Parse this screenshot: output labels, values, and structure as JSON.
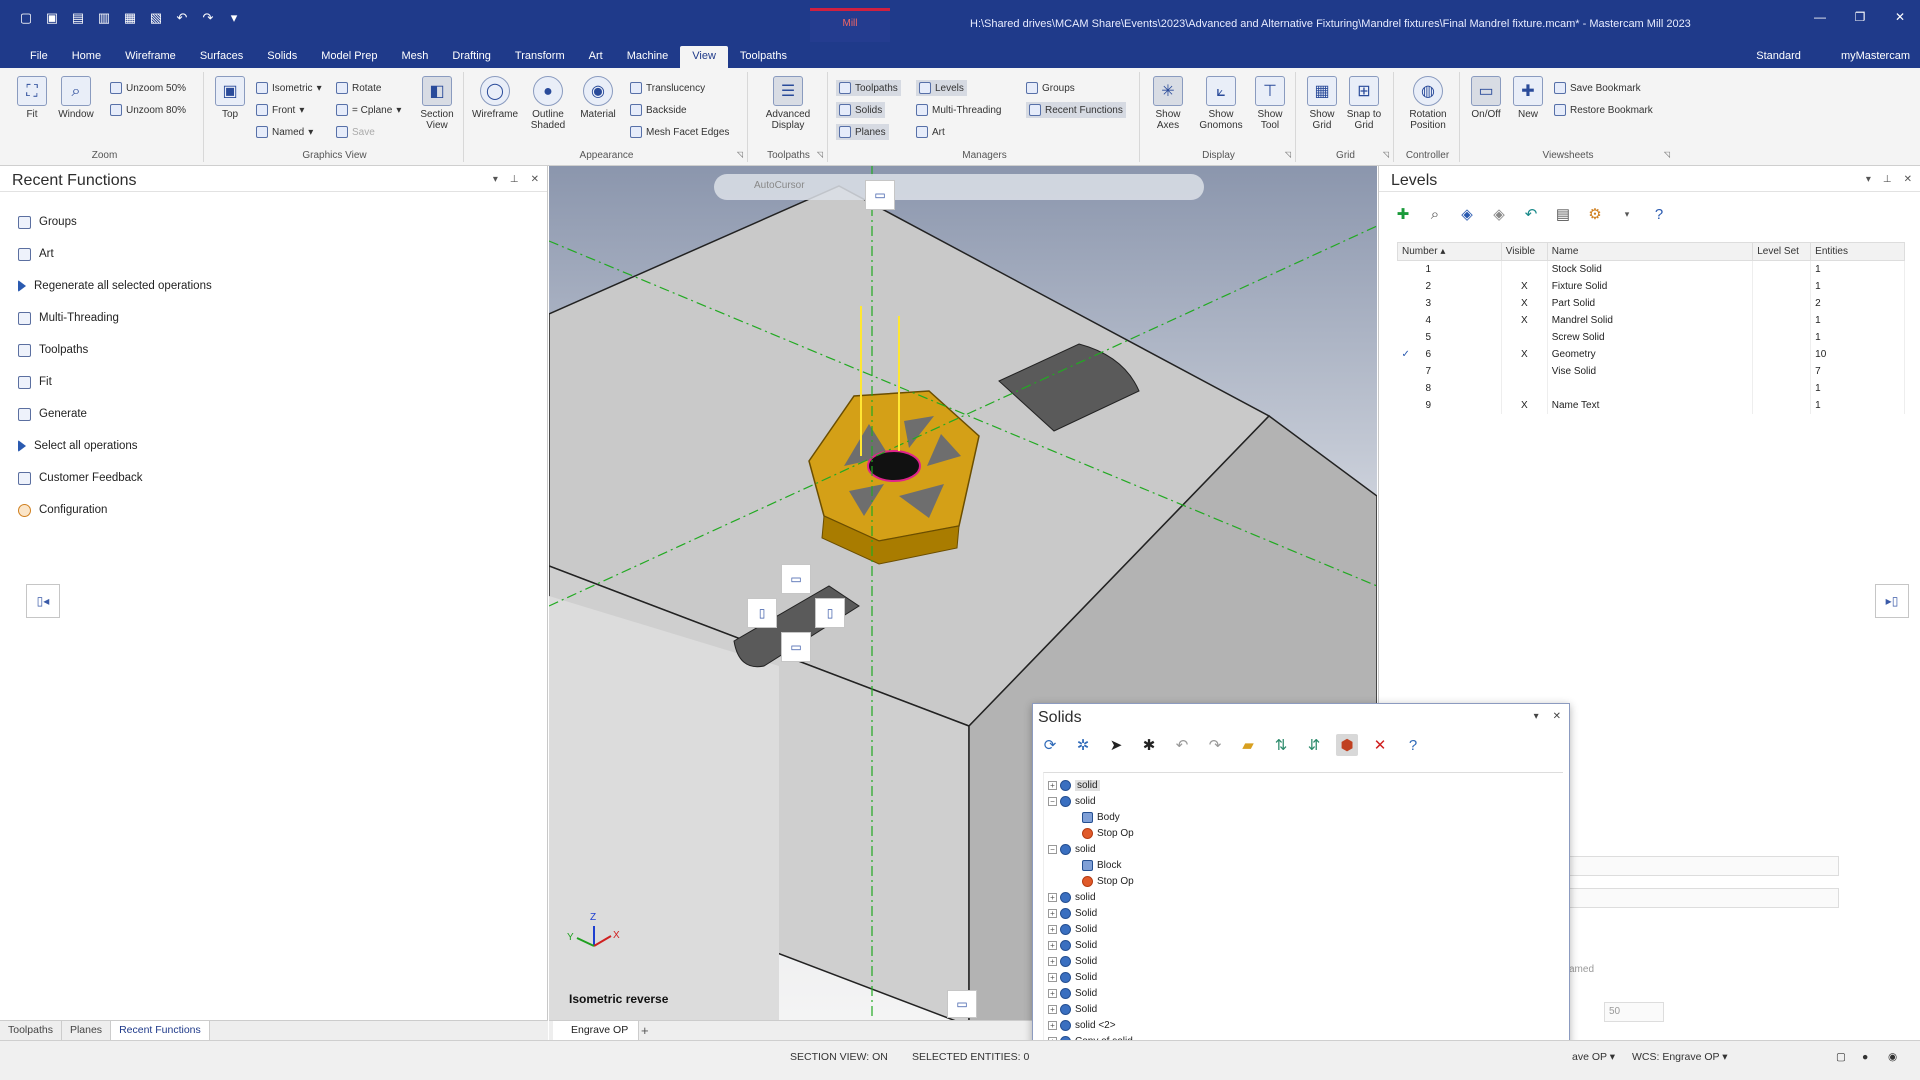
{
  "titlebar": {
    "title": "H:\\Shared drives\\MCAM Share\\Events\\2023\\Advanced and Alternative Fixturing\\Mandrel fixtures\\Final Mandrel fixture.mcam* - Mastercam Mill 2023",
    "machine_tab": "Mill"
  },
  "menu": {
    "tabs": [
      "File",
      "Home",
      "Wireframe",
      "Surfaces",
      "Solids",
      "Model Prep",
      "Mesh",
      "Drafting",
      "Transform",
      "Art",
      "Machine",
      "View",
      "Toolpaths"
    ],
    "workspace": "Standard",
    "account": "myMastercam"
  },
  "ribbon": {
    "zoom": {
      "label": "Zoom",
      "fit": "Fit",
      "window": "Window",
      "unzoom50": "Unzoom 50%",
      "unzoom80": "Unzoom 80%"
    },
    "graphics_view": {
      "label": "Graphics View",
      "top": "Top",
      "isometric": "Isometric",
      "front": "Front",
      "named": "Named",
      "rotate": "Rotate",
      "cplane": "= Cplane",
      "save": "Save",
      "section_view": "Section View"
    },
    "appearance": {
      "label": "Appearance",
      "wireframe": "Wireframe",
      "outline_shaded": "Outline Shaded",
      "material": "Material",
      "translucency": "Translucency",
      "backside": "Backside",
      "mesh_facet_edges": "Mesh Facet Edges"
    },
    "toolpaths_group": {
      "label": "Toolpaths",
      "advanced_display": "Advanced Display"
    },
    "managers": {
      "label": "Managers",
      "toolpaths": "Toolpaths",
      "solids": "Solids",
      "planes": "Planes",
      "levels": "Levels",
      "multi_threading": "Multi-Threading",
      "art": "Art",
      "groups": "Groups",
      "recent_functions": "Recent Functions"
    },
    "display": {
      "label": "Display",
      "show_axes": "Show Axes",
      "show_gnomons": "Show Gnomons",
      "show_tool": "Show Tool"
    },
    "grid": {
      "label": "Grid",
      "show_grid": "Show Grid",
      "snap_to_grid": "Snap to Grid"
    },
    "controller": {
      "label": "Controller",
      "rotation_position": "Rotation Position"
    },
    "viewsheets": {
      "label": "Viewsheets",
      "onoff": "On/Off",
      "new": "New",
      "save_bookmark": "Save Bookmark",
      "restore_bookmark": "Restore Bookmark"
    }
  },
  "recent_functions": {
    "title": "Recent Functions",
    "items": [
      {
        "label": "Groups",
        "icon": "groups-icon"
      },
      {
        "label": "Art",
        "icon": "art-icon"
      },
      {
        "label": "Regenerate all selected operations",
        "icon": "regenerate-icon"
      },
      {
        "label": "Multi-Threading",
        "icon": "multi-threading-icon"
      },
      {
        "label": "Toolpaths",
        "icon": "toolpaths-icon"
      },
      {
        "label": "Fit",
        "icon": "fit-icon"
      },
      {
        "label": "Generate",
        "icon": "generate-icon"
      },
      {
        "label": "Select all operations",
        "icon": "select-all-icon"
      },
      {
        "label": "Customer Feedback",
        "icon": "feedback-icon"
      },
      {
        "label": "Configuration",
        "icon": "gear-icon"
      }
    ],
    "bottom_tabs": [
      "Toolpaths",
      "Planes",
      "Recent Functions"
    ]
  },
  "viewport": {
    "autocursor": "AutoCursor",
    "view_name": "Isometric reverse",
    "tab": "Engrave OP",
    "gnomon": {
      "x": "X",
      "y": "Y",
      "z": "Z"
    }
  },
  "levels": {
    "title": "Levels",
    "columns": [
      "Number",
      "Visible",
      "Name",
      "Level Set",
      "Entities"
    ],
    "rows": [
      {
        "num": "1",
        "check": "",
        "vis": "",
        "name": "Stock Solid",
        "set": "",
        "ent": "1"
      },
      {
        "num": "2",
        "check": "",
        "vis": "X",
        "name": "Fixture Solid",
        "set": "",
        "ent": "1"
      },
      {
        "num": "3",
        "check": "",
        "vis": "X",
        "name": "Part Solid",
        "set": "",
        "ent": "2"
      },
      {
        "num": "4",
        "check": "",
        "vis": "X",
        "name": "Mandrel Solid",
        "set": "",
        "ent": "1"
      },
      {
        "num": "5",
        "check": "",
        "vis": "",
        "name": "Screw Solid",
        "set": "",
        "ent": "1"
      },
      {
        "num": "6",
        "check": "✓",
        "vis": "X",
        "name": "Geometry",
        "set": "",
        "ent": "10"
      },
      {
        "num": "7",
        "check": "",
        "vis": "",
        "name": "Vise Solid",
        "set": "",
        "ent": "7"
      },
      {
        "num": "8",
        "check": "",
        "vis": "",
        "name": "",
        "set": "",
        "ent": "1"
      },
      {
        "num": "9",
        "check": "",
        "vis": "X",
        "name": "Name Text",
        "set": "",
        "ent": "1"
      }
    ],
    "partial_text": "amed",
    "field_value": "50"
  },
  "solids": {
    "title": "Solids",
    "tree": [
      {
        "label": "solid",
        "depth": 0,
        "exp": "+",
        "icon": "solid",
        "hl": true
      },
      {
        "label": "solid",
        "depth": 0,
        "exp": "−",
        "icon": "solid"
      },
      {
        "label": "Body",
        "depth": 1,
        "exp": "",
        "icon": "feat"
      },
      {
        "label": "Stop Op",
        "depth": 1,
        "exp": "",
        "icon": "op"
      },
      {
        "label": "solid",
        "depth": 0,
        "exp": "−",
        "icon": "solid"
      },
      {
        "label": "Block",
        "depth": 1,
        "exp": "",
        "icon": "feat"
      },
      {
        "label": "Stop Op",
        "depth": 1,
        "exp": "",
        "icon": "op"
      },
      {
        "label": "solid",
        "depth": 0,
        "exp": "+",
        "icon": "solid"
      },
      {
        "label": "Solid",
        "depth": 0,
        "exp": "+",
        "icon": "solid"
      },
      {
        "label": "Solid",
        "depth": 0,
        "exp": "+",
        "icon": "solid"
      },
      {
        "label": "Solid",
        "depth": 0,
        "exp": "+",
        "icon": "solid"
      },
      {
        "label": "Solid",
        "depth": 0,
        "exp": "+",
        "icon": "solid"
      },
      {
        "label": "Solid",
        "depth": 0,
        "exp": "+",
        "icon": "solid"
      },
      {
        "label": "Solid",
        "depth": 0,
        "exp": "+",
        "icon": "solid"
      },
      {
        "label": "Solid",
        "depth": 0,
        "exp": "+",
        "icon": "solid"
      },
      {
        "label": "solid <2>",
        "depth": 0,
        "exp": "+",
        "icon": "solid"
      },
      {
        "label": "Copy of solid",
        "depth": 0,
        "exp": "+",
        "icon": "solid"
      }
    ]
  },
  "statusbar": {
    "section_view": "SECTION VIEW: ON",
    "selected": "SELECTED ENTITIES: 0",
    "plane": "ave OP",
    "wcs": "WCS: Engrave OP"
  },
  "colors": {
    "titlebar": "#1f3a8a",
    "fixture": "#d4a017",
    "accent_red": "#d02040"
  }
}
